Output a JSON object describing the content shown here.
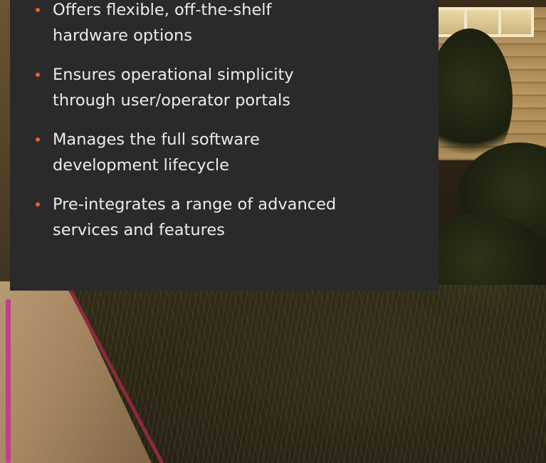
{
  "panel": {
    "bullets": [
      {
        "text": "Offers flexible, off-the-shelf\nhardware options"
      },
      {
        "text": "Ensures operational simplicity\nthrough user/operator portals"
      },
      {
        "text": "Manages the full software\ndevelopment lifecycle"
      },
      {
        "text": "Pre-integrates a range of advanced\nservices and features"
      }
    ],
    "bullet_color": "#e8612c",
    "panel_background": "#2a2a2a",
    "text_color": "#ececec"
  },
  "background": {
    "description_icon": "photo-background"
  }
}
